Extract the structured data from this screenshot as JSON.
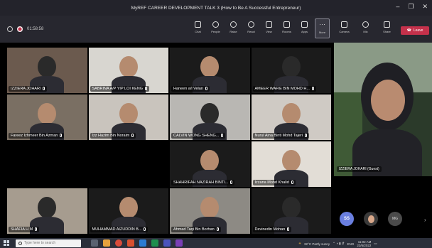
{
  "window": {
    "title": "MyREF CAREER DEVELOPMENT TALK 3 (How to Be A Successful Entrepreneur)",
    "controls": [
      "–",
      "❐",
      "✕"
    ]
  },
  "toolbar": {
    "timer": "01:58:58",
    "buttons": [
      {
        "label": "Chat",
        "icon": "chat-icon"
      },
      {
        "label": "People",
        "icon": "people-icon"
      },
      {
        "label": "Raise",
        "icon": "raise-hand-icon"
      },
      {
        "label": "React",
        "icon": "react-icon"
      },
      {
        "label": "View",
        "icon": "view-icon"
      },
      {
        "label": "Rooms",
        "icon": "rooms-icon"
      },
      {
        "label": "Apps",
        "icon": "apps-icon"
      },
      {
        "label": "More",
        "icon": "more-icon"
      }
    ],
    "device_buttons": [
      {
        "label": "Camera",
        "icon": "camera-icon"
      },
      {
        "label": "Mic",
        "icon": "mic-icon"
      },
      {
        "label": "Share",
        "icon": "share-icon"
      }
    ],
    "leave_label": "Leave"
  },
  "tiles": [
    {
      "name": "IZZIERA JOHARI",
      "bg": "#6b5a4e"
    },
    {
      "name": "SABRINA A/P YIP LOI KENG",
      "bg": "#d8d6d0"
    },
    {
      "name": "Haneen a/l Velan",
      "bg": "#1b1b1b"
    },
    {
      "name": "AMEER WAFIE BIN MOHD H...",
      "bg": "#1b1b1b"
    },
    {
      "name": "Fareez Izhmeer Bin Azman",
      "bg": "#7a6f63"
    },
    {
      "name": "Izz Hazim Bin Noraim",
      "bg": "#c9c4bd"
    },
    {
      "name": "CALVIN WONG SHENG...",
      "bg": "#b9b7b3"
    },
    {
      "name": "Nurul Aina Binti Mohd Tajeri",
      "bg": "#cfcac4"
    },
    {
      "name": "",
      "bg": "#000000"
    },
    {
      "name": "",
      "bg": "#000000"
    },
    {
      "name": "SHAHRIFAH NAZIRAH BINTI...",
      "bg": "#1b1b1b"
    },
    {
      "name": "Izzana Mohd Khalid",
      "bg": "#e2ddd6"
    },
    {
      "name": "SHAFIA H M",
      "bg": "#a69c8f"
    },
    {
      "name": "MUHAMMAD AIZUDDIN B...",
      "bg": "#1b1b1b"
    },
    {
      "name": "Ahmad Taqi Bin Borhan",
      "bg": "#8d8a84"
    },
    {
      "name": "Devinedin Mohan",
      "bg": "#1b1b1b"
    }
  ],
  "speaker": {
    "name": "IZZIERA JOHARI (Guest)"
  },
  "self_avatars": {
    "initials": "SS",
    "third": "MG"
  },
  "taskbar": {
    "search_placeholder": "Type here to search",
    "weather": "32°C Partly sunny",
    "language": "ENG",
    "time": "11:02 AM",
    "date": "23/6/2022"
  }
}
